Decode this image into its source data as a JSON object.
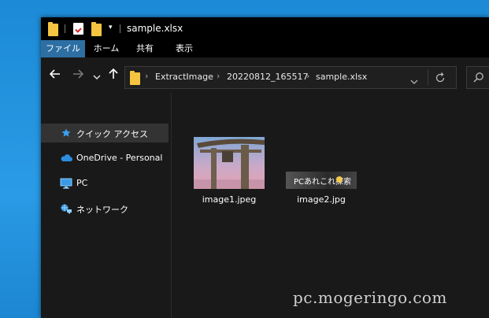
{
  "window": {
    "title": "sample.xlsx"
  },
  "ribbon": {
    "tabs": [
      "ファイル",
      "ホーム",
      "共有",
      "表示"
    ]
  },
  "navbar": {
    "back_icon": "arrow-left",
    "forward_icon": "arrow-right",
    "recent_icon": "chevron-down",
    "up_icon": "arrow-up",
    "breadcrumbs": [
      "ExtractImage",
      "20220812_165517",
      "sample.xlsx"
    ],
    "breadcrumb_separator": "›",
    "dropdown_icon": "chevron-down",
    "refresh_icon": "refresh",
    "search_icon": "search"
  },
  "sidebar": {
    "items": [
      {
        "label": "クイック アクセス",
        "icon": "star-icon",
        "selected": true
      },
      {
        "label": "OneDrive - Personal",
        "icon": "cloud-icon",
        "selected": false
      },
      {
        "label": "PC",
        "icon": "monitor-icon",
        "selected": false
      },
      {
        "label": "ネットワーク",
        "icon": "network-icon",
        "selected": false
      }
    ]
  },
  "files": [
    {
      "name": "image1.jpeg",
      "thumb": "torii-gate-photo"
    },
    {
      "name": "image2.jpg",
      "thumb": "pc-banner",
      "thumb_text": "PCあれこれ探索"
    }
  ],
  "watermark": "pc.mogeringo.com",
  "colors": {
    "titlebar": "#000000",
    "window": "#191919",
    "ribbon_active": "#2d6fa3",
    "selection": "#333333",
    "desktop": "#1e8fd8",
    "folder": "#f5c542"
  }
}
